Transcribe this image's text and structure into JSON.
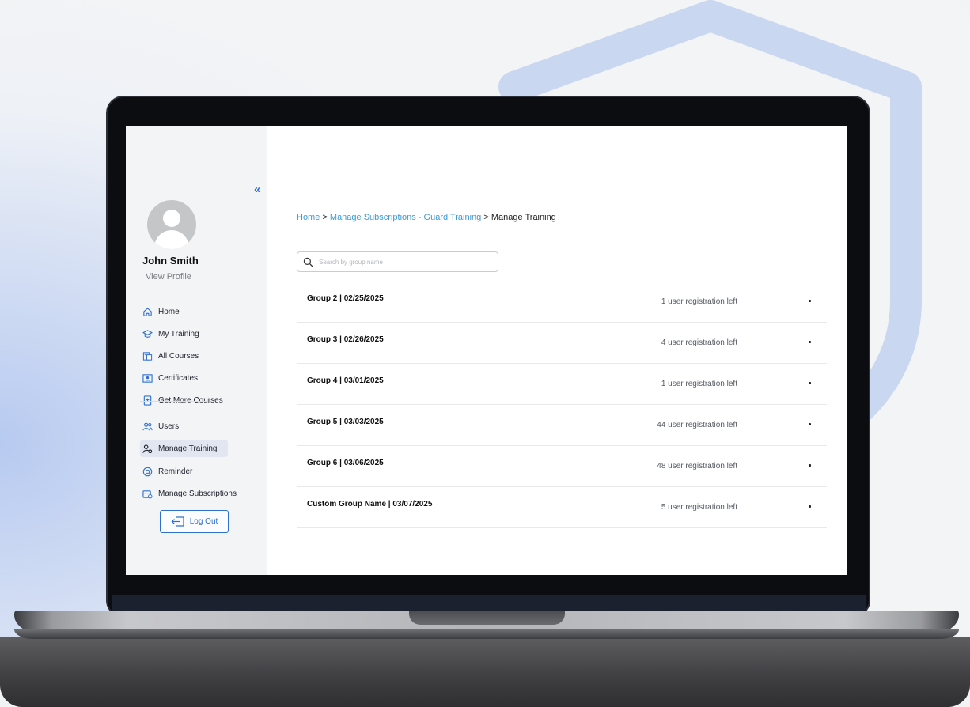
{
  "sidebar": {
    "collapse_glyph": "«",
    "user_name": "John Smith",
    "view_profile": "View Profile",
    "items": [
      {
        "label": "Home",
        "icon": "home-icon"
      },
      {
        "label": "My Training",
        "icon": "graduation-cap-icon"
      },
      {
        "label": "All Courses",
        "icon": "courses-icon"
      },
      {
        "label": "Certificates",
        "icon": "certificate-icon"
      },
      {
        "label": "Get More Courses",
        "icon": "book-add-icon"
      },
      {
        "label": "Users",
        "icon": "users-icon"
      },
      {
        "label": "Manage Training",
        "icon": "user-gear-icon",
        "active": true
      },
      {
        "label": "Reminder",
        "icon": "reminder-icon"
      },
      {
        "label": "Manage Subscriptions",
        "icon": "subscriptions-icon"
      }
    ],
    "logout_label": "Log Out"
  },
  "breadcrumb": {
    "home": "Home",
    "sep": ">",
    "subscriptions": "Manage Subscriptions - Guard Training",
    "current": "Manage Training"
  },
  "search": {
    "placeholder": "Search by group name",
    "value": ""
  },
  "groups": [
    {
      "name": "Group 2 | 02/25/2025",
      "registrations": "1 user registration left"
    },
    {
      "name": "Group 3 | 02/26/2025",
      "registrations": "4 user registration left"
    },
    {
      "name": "Group 4 | 03/01/2025",
      "registrations": "1 user registration left"
    },
    {
      "name": "Group 5 | 03/03/2025",
      "registrations": "44 user registration left"
    },
    {
      "name": "Group 6 | 03/06/2025",
      "registrations": "48 user registration left"
    },
    {
      "name": "Custom Group Name | 03/07/2025",
      "registrations": "5 user registration left"
    }
  ],
  "colors": {
    "accent": "#2f6fd0",
    "link": "#3d9ad1",
    "active_nav_bg": "#e1e6f1"
  }
}
